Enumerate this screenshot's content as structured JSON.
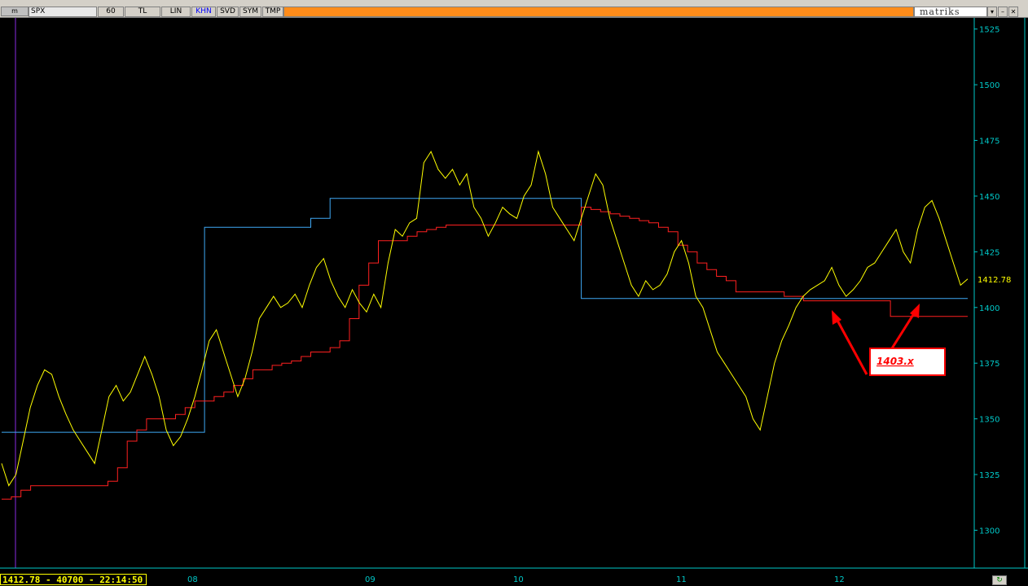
{
  "toolbar": {
    "logo": "m",
    "symbol": "SPX",
    "interval": "60",
    "currency": "TL",
    "scale": "LIN",
    "buttons": [
      "KHN",
      "SVD",
      "SYM",
      "TMP"
    ],
    "active_button": "KHN",
    "brand": "matriks",
    "dropdown_icon": "chevron-down-icon",
    "minimize_icon": "minimize-icon",
    "close_icon": "close-icon"
  },
  "status_bar": {
    "text": "1412.78 - 40700 - 22:14:50",
    "date_ticks": [
      "08",
      "09",
      "10",
      "11",
      "12"
    ],
    "corner_icon": "refresh-icon"
  },
  "colors": {
    "background": "#000000",
    "price": "#ffff00",
    "support": "#ff2020",
    "resistance": "#3fa9f5",
    "axis": "#00c8c8",
    "annotation": "#ff0000",
    "toolbar_accent": "#ff8c1a"
  },
  "chart_data": {
    "type": "line",
    "y_axis_position": "right",
    "ylim": [
      1283,
      1530
    ],
    "y_ticks": [
      1300,
      1325,
      1350,
      1375,
      1400,
      1425,
      1450,
      1475,
      1500,
      1525
    ],
    "x_ticks": [
      "08",
      "09",
      "10",
      "11",
      "12"
    ],
    "last_price": "1412.78",
    "series": [
      {
        "values": [
          1330,
          1320,
          1325,
          1340,
          1355,
          1365,
          1372,
          1370,
          1360,
          1352,
          1345,
          1340,
          1335,
          1330,
          1345,
          1360,
          1365,
          1358,
          1362,
          1370,
          1378,
          1370,
          1360,
          1345,
          1338,
          1342,
          1350,
          1360,
          1372,
          1385,
          1390,
          1380,
          1370,
          1360,
          1368,
          1380,
          1395,
          1400,
          1405,
          1400,
          1402,
          1406,
          1400,
          1410,
          1418,
          1422,
          1412,
          1405,
          1400,
          1408,
          1402,
          1398,
          1406,
          1400,
          1420,
          1435,
          1432,
          1438,
          1440,
          1465,
          1470,
          1462,
          1458,
          1462,
          1455,
          1460,
          1445,
          1440,
          1432,
          1438,
          1445,
          1442,
          1440,
          1450,
          1455,
          1470,
          1460,
          1445,
          1440,
          1435,
          1430,
          1440,
          1450,
          1460,
          1455,
          1440,
          1430,
          1420,
          1410,
          1405,
          1412,
          1408,
          1410,
          1415,
          1425,
          1430,
          1420,
          1405,
          1400,
          1390,
          1380,
          1375,
          1370,
          1365,
          1360,
          1350,
          1345,
          1360,
          1375,
          1385,
          1392,
          1400,
          1405,
          1408,
          1410,
          1412,
          1418,
          1410,
          1405,
          1408,
          1412,
          1418,
          1420,
          1425,
          1430,
          1435,
          1425,
          1420,
          1435,
          1445,
          1448,
          1440,
          1430,
          1420,
          1410,
          1412.78
        ]
      },
      {
        "values": [
          1314,
          1315,
          1318,
          1320,
          1320,
          1320,
          1320,
          1320,
          1320,
          1320,
          1320,
          1322,
          1328,
          1340,
          1345,
          1350,
          1350,
          1350,
          1352,
          1355,
          1358,
          1358,
          1360,
          1362,
          1365,
          1368,
          1372,
          1372,
          1374,
          1375,
          1376,
          1378,
          1380,
          1380,
          1382,
          1385,
          1395,
          1410,
          1420,
          1430,
          1430,
          1430,
          1432,
          1434,
          1435,
          1436,
          1437,
          1437,
          1437,
          1437,
          1437,
          1437,
          1437,
          1437,
          1437,
          1437,
          1437,
          1437,
          1437,
          1437,
          1445,
          1444,
          1443,
          1442,
          1441,
          1440,
          1439,
          1438,
          1436,
          1434,
          1428,
          1425,
          1420,
          1417,
          1414,
          1412,
          1407,
          1407,
          1407,
          1407,
          1407,
          1405,
          1405,
          1403,
          1403,
          1403,
          1403,
          1403,
          1403,
          1403,
          1403,
          1403,
          1396,
          1396,
          1396,
          1396,
          1396,
          1396,
          1396,
          1396,
          1396
        ]
      },
      {
        "values": [
          1344,
          1344,
          1344,
          1344,
          1344,
          1344,
          1344,
          1344,
          1344,
          1344,
          1344,
          1344,
          1344,
          1344,
          1344,
          1344,
          1344,
          1344,
          1344,
          1344,
          1344,
          1436,
          1436,
          1436,
          1436,
          1436,
          1436,
          1436,
          1436,
          1436,
          1436,
          1436,
          1440,
          1440,
          1449,
          1449,
          1449,
          1449,
          1449,
          1449,
          1449,
          1449,
          1449,
          1449,
          1449,
          1449,
          1449,
          1449,
          1449,
          1449,
          1449,
          1449,
          1449,
          1449,
          1449,
          1449,
          1449,
          1449,
          1449,
          1449,
          1404,
          1404,
          1404,
          1404,
          1404,
          1404,
          1404,
          1404,
          1404,
          1404,
          1404,
          1404,
          1404,
          1404,
          1404,
          1404,
          1404,
          1404,
          1404,
          1404,
          1404,
          1404,
          1404,
          1404,
          1404,
          1404,
          1404,
          1404,
          1404,
          1404,
          1404,
          1404,
          1404,
          1404,
          1404,
          1404,
          1404,
          1404,
          1404,
          1404,
          1404
        ]
      }
    ],
    "annotations": [
      {
        "text": "1403.x"
      }
    ]
  }
}
